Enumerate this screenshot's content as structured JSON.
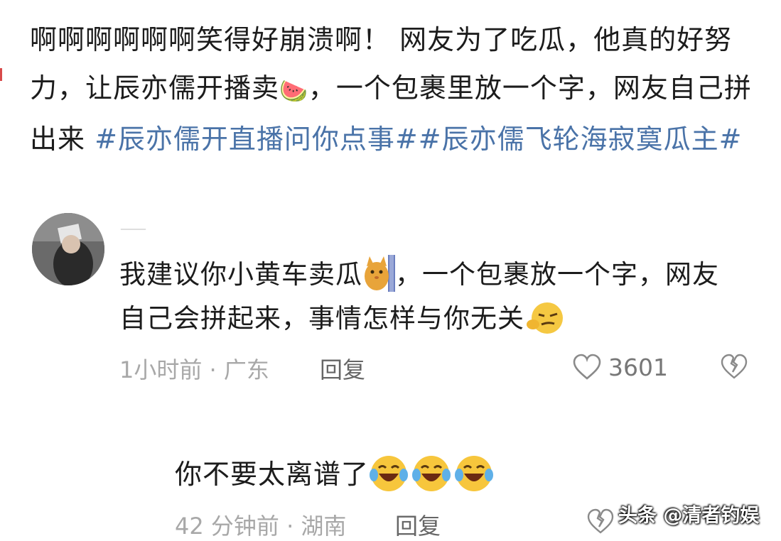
{
  "post": {
    "text": "啊啊啊啊啊啊笑得好崩溃啊！ 网友为了吃瓜，他真的好努力，让辰亦儒开播卖",
    "text_after_emoji": "，一个包裹里放一个字，网友自己拼出来 ",
    "hashtag1": "#辰亦儒开直播问你点事#",
    "hashtag2": "#辰亦儒飞轮海寂寞瓜主#",
    "emoji_icon": "watermelon-icon"
  },
  "comment": {
    "text_part1": "我建议你小黄车卖瓜",
    "text_part2": "，一个包裹放一个字，网友自己会拼起来，事情怎样与你无关",
    "time_location": "1小时前 · 广东",
    "reply_label": "回复",
    "like_count": "3601",
    "icons": [
      "avatar",
      "cat-emoji-icon",
      "sly-face-emoji-icon",
      "heart-icon",
      "broken-heart-icon"
    ]
  },
  "reply": {
    "text": "你不要太离谱了",
    "time_location": "42 分钟前 · 湖南",
    "reply_label": "回复",
    "icons": [
      "laughing-crying-emoji-icon",
      "broken-heart-icon"
    ]
  },
  "watermark": "头条 @清者钓娱",
  "colors": {
    "hashtag": "#4a73a8",
    "meta": "#a8a8a8",
    "text": "#1c1c1c"
  }
}
